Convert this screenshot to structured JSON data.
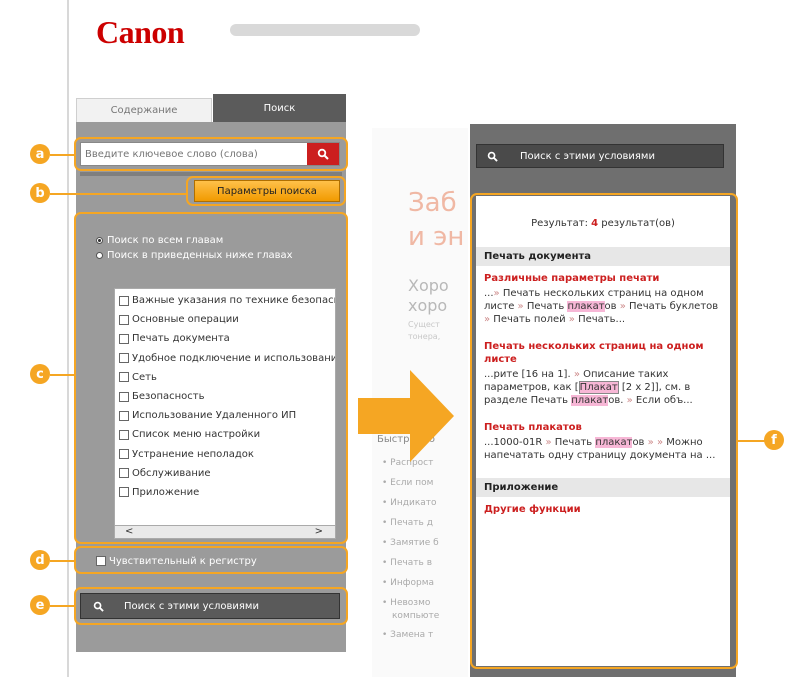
{
  "logo": "Canon",
  "tabs": [
    {
      "label": "Содержание"
    },
    {
      "label": "Поиск"
    }
  ],
  "search": {
    "placeholder": "Введите ключевое слово (слова)"
  },
  "options_button": "Параметры поиска",
  "scope": [
    {
      "label": "Поиск по всем главам",
      "selected": true
    },
    {
      "label": "Поиск в приведенных ниже главах",
      "selected": false
    }
  ],
  "chapters": [
    "Важные указания по технике безопасности",
    "Основные операции",
    "Печать документа",
    "Удобное подключение и использование",
    "Сеть",
    "Безопасность",
    "Использование Удаленного ИП",
    "Список меню настройки",
    "Устранение неполадок",
    "Обслуживание",
    "Приложение"
  ],
  "scroll": {
    "left": "<",
    "right": ">"
  },
  "case_sensitive": "Чувствительный к регистру",
  "search_cond_button": "Поиск с этими условиями",
  "badges": {
    "a": "a",
    "b": "b",
    "c": "c",
    "d": "d",
    "e": "e",
    "f": "f"
  },
  "middle_page": {
    "title1": "Заб",
    "title2": "и эн",
    "sub1": "Хоро",
    "sub2": "хоро",
    "small1": "Сущест",
    "small2": "тонера,",
    "quick_heading": "Быстр й по",
    "bullets": [
      "Распрост",
      "Если пом",
      "Индикато",
      "Печать д",
      "Замятие б",
      "Печать в",
      "Информа",
      "Невозмо",
      "компьюте",
      "Замена т"
    ]
  },
  "results": {
    "summary_prefix": "Результат: ",
    "count": "4",
    "summary_suffix": " результат(ов)",
    "sec1_heading": "Печать документа",
    "r1_title": "Различные параметры печати",
    "r1_text1": "...",
    "r1_text2": " Печать нескольких страниц на одном листе ",
    "r1_text3": " Печать ",
    "r1_hl": "плакат",
    "r1_text4": "ов ",
    "r1_text5": " Печать буклетов ",
    "r1_text6": " Печать полей ",
    "r1_text7": " Печать...",
    "r2_title": "Печать нескольких страниц на одном листе",
    "r2_text1": "...рите [16 на 1]. ",
    "r2_text2": " Описание таких параметров, как [",
    "r2_hl1": "Плакат",
    "r2_text3": " [2 x 2]], см. в разделе Печать ",
    "r2_hl2": "плакат",
    "r2_text4": "ов. ",
    "r2_text5": " Если объ...",
    "r3_title": "Печать плакатов",
    "r3_text1": "...1000-01R ",
    "r3_text2": " Печать ",
    "r3_hl": "плакат",
    "r3_text3": "ов ",
    "r3_text4": " ",
    "r3_text5": " Можно напечатать одну страницу документа на ...",
    "sec2_heading": "Приложение",
    "r4_title": "Другие функции"
  },
  "colors": {
    "accent_orange": "#f5a623",
    "brand_red": "#cc0000",
    "highlight": "#f7b7d6"
  }
}
